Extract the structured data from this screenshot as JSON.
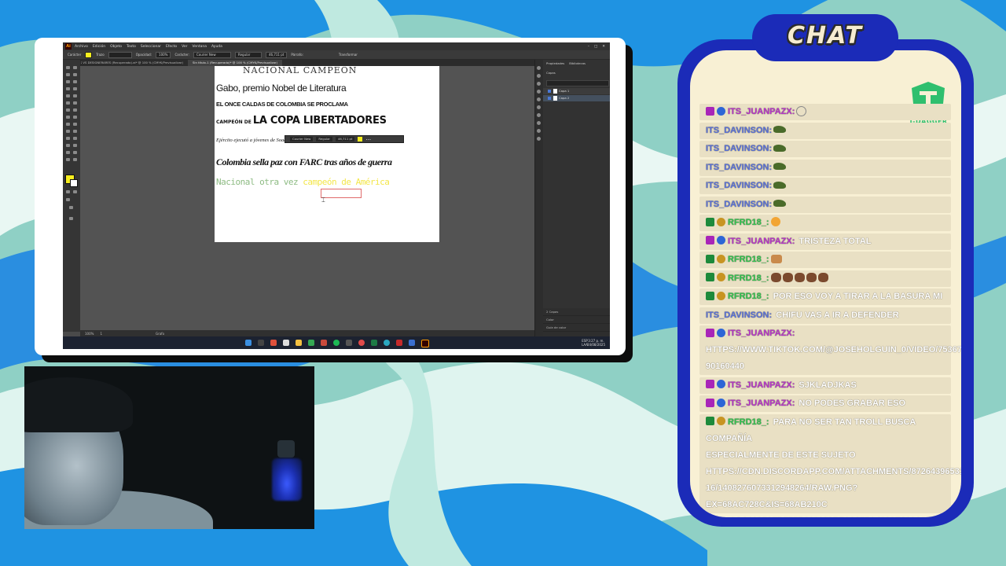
{
  "chat": {
    "title": "CHAT",
    "logo_text": "T-DAGGER",
    "colors": {
      "panel": "#1b2bb8",
      "paper": "#f8f0d4",
      "moderator_name": "#31c04f",
      "subscriber_name": "#b534c8",
      "viewer_name": "#5870d8"
    },
    "messages": [
      {
        "badges": [
          "tv",
          "check"
        ],
        "user": "ITS_JUANPAZX:",
        "text": "",
        "emote": "circle"
      },
      {
        "badges": [],
        "user": "ITS_DAVINSON:",
        "text": "",
        "emote": "cat"
      },
      {
        "badges": [],
        "user": "ITS_DAVINSON:",
        "text": "",
        "emote": "cat"
      },
      {
        "badges": [],
        "user": "ITS_DAVINSON:",
        "text": "",
        "emote": "cat"
      },
      {
        "badges": [],
        "user": "ITS_DAVINSON:",
        "text": "",
        "emote": "cat"
      },
      {
        "badges": [],
        "user": "ITS_DAVINSON:",
        "text": "",
        "emote": "cat"
      },
      {
        "badges": [
          "pencil",
          "crown"
        ],
        "user": "RFRD18_:",
        "text": "",
        "emote": "sad-face"
      },
      {
        "badges": [
          "tv",
          "check"
        ],
        "user": "ITS_JUANPAZX:",
        "text": "TRISTEZA TOTAL"
      },
      {
        "badges": [
          "pencil",
          "crown"
        ],
        "user": "RFRD18_:",
        "text": "",
        "emote": "open-hands"
      },
      {
        "badges": [
          "pencil",
          "crown"
        ],
        "user": "RFRD18_:",
        "text": "",
        "emote": "monkey-x5"
      },
      {
        "badges": [
          "pencil",
          "crown"
        ],
        "user": "RFRD18_:",
        "text": "POR ESO VOY A TIRAR A LA BASURA MI CELULAR"
      },
      {
        "badges": [],
        "user": "ITS_DAVINSON:",
        "text": "CHIFU VAS A IR A DEFENDER VENEZUELA?"
      },
      {
        "badges": [
          "tv",
          "check"
        ],
        "user": "ITS_JUANPAZX:",
        "lines": [
          "HTTPS://WWW.TIKTOK.COM/@JOSEHOLGUIN_0/VIDEO/75367367696",
          "90160440"
        ]
      },
      {
        "badges": [
          "tv",
          "check"
        ],
        "user": "ITS_JUANPAZX:",
        "text": "SJKLADJKAS"
      },
      {
        "badges": [
          "tv",
          "check"
        ],
        "user": "ITS_JUANPAZX:",
        "text": "NO PODES GRABAR ESO"
      },
      {
        "badges": [
          "pencil",
          "crown"
        ],
        "user": "RFRD18_:",
        "text": "PARA NO SER TAN TROLL BUSCA COMPAÑÍA",
        "lines": [
          "ESPECIALMENTE DE ESTE SUJETO",
          "HTTPS://CDN.DISCORDAPP.COM/ATTACHMENTS/872643965311235",
          "16/1408276073312948264/RAW.PNG?EX=68AC728C&IS=68AB210C",
          "&HM=2CC19976FB575B810128B5A9375A4098E801AD5F82107CC32",
          "629F94D309BB6516"
        ]
      }
    ]
  },
  "illustrator": {
    "app_logo": "Ai",
    "menu": [
      "Archivo",
      "Edición",
      "Objeto",
      "Texto",
      "Seleccionar",
      "Efecto",
      "Ver",
      "Ventana",
      "Ayuda"
    ],
    "control_bar": {
      "label_left": "Carácter",
      "stroke_label": "Trazo",
      "opacity_label": "Opacidad:",
      "opacity": "100%",
      "char_label": "Carácter:",
      "font": "Courier New",
      "style": "Regular",
      "size": "46,711 pt",
      "para_label": "Párrafo:",
      "transform": "Transformar"
    },
    "tabs": [
      "ALCES VS DESIGNERARES (Recuperado).ai* @ 100 % (CMYK/Previsualizar)",
      "Sin título-1 (Recuperado)* @ 100 % (CMYK/Previsualizar)"
    ],
    "active_tab": 1,
    "artboard_lines": {
      "l1": "NACIONAL CAMPEÓN",
      "l2": "Gabo, premio Nobel de Literatura",
      "l3": "EL ONCE CALDAS DE COLOMBIA SE PROCLAMA",
      "l4_small": "CAMPEÓN DE",
      "l4_big": "LA COPA LIBERTADORES",
      "l5": "Ejército ejecutó a jóvenes de Soacha y los presentó como guerrilleros dados de baja",
      "l6": "Colombia sella paz con FARC tras años de guerra",
      "l7a": "Nacional otra vez ",
      "l7b": "campeón de América"
    },
    "float_control": {
      "font": "Courier New",
      "style": "Regular",
      "size": "46,711 pt"
    },
    "status": {
      "zoom": "100%",
      "page": "1",
      "tool": "Grafo"
    },
    "panels": {
      "tabs": [
        "Propiedades",
        "Bibliotecas"
      ],
      "layers_label": "Capas",
      "layers": [
        "Capa 1",
        "Capa 2"
      ],
      "bottom": [
        "2 Capas",
        "Color",
        "Guía de color"
      ]
    },
    "taskbar": {
      "lang1": "ESP",
      "lang2": "LAA",
      "time": "3:27 p. m.",
      "date": "24/08/2025"
    }
  }
}
